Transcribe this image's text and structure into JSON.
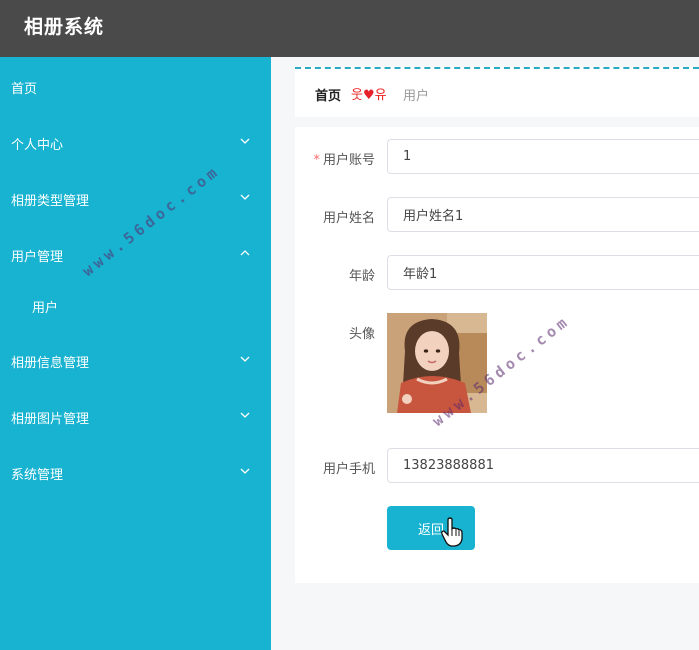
{
  "header": {
    "title": "相册系统"
  },
  "sidebar": {
    "items": [
      {
        "label": "首页"
      },
      {
        "label": "个人中心"
      },
      {
        "label": "相册类型管理"
      },
      {
        "label": "用户管理"
      },
      {
        "label": "用户"
      },
      {
        "label": "相册信息管理"
      },
      {
        "label": "相册图片管理"
      },
      {
        "label": "系统管理"
      }
    ]
  },
  "breadcrumb": {
    "home": "首页",
    "separator_left": "웃",
    "separator_right": "유",
    "current": "用户"
  },
  "form": {
    "account_label": "用户账号",
    "account_required": "*",
    "account_value": "1",
    "name_label": "用户姓名",
    "name_value": "用户姓名1",
    "age_label": "年龄",
    "age_value": "年龄1",
    "avatar_label": "头像",
    "phone_label": "用户手机",
    "phone_value": "13823888881",
    "back_label": "返回"
  },
  "watermark": {
    "text": "www.56doc.com"
  },
  "colors": {
    "accent": "#17b3d0",
    "header": "#4a4a4a",
    "required": "#f56c6c"
  }
}
